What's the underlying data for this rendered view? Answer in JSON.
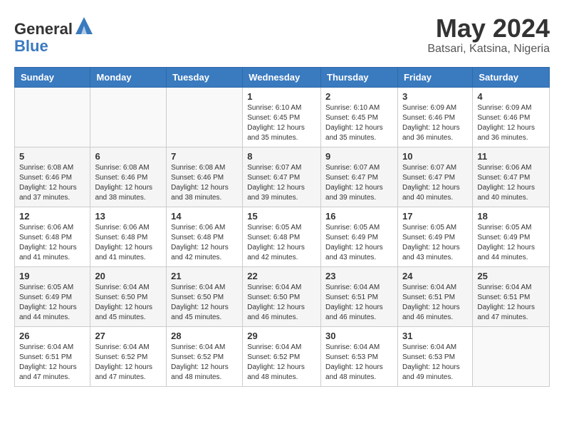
{
  "header": {
    "logo_general": "General",
    "logo_blue": "Blue",
    "month_title": "May 2024",
    "location": "Batsari, Katsina, Nigeria"
  },
  "weekdays": [
    "Sunday",
    "Monday",
    "Tuesday",
    "Wednesday",
    "Thursday",
    "Friday",
    "Saturday"
  ],
  "weeks": [
    [
      {
        "day": "",
        "info": ""
      },
      {
        "day": "",
        "info": ""
      },
      {
        "day": "",
        "info": ""
      },
      {
        "day": "1",
        "info": "Sunrise: 6:10 AM\nSunset: 6:45 PM\nDaylight: 12 hours\nand 35 minutes."
      },
      {
        "day": "2",
        "info": "Sunrise: 6:10 AM\nSunset: 6:45 PM\nDaylight: 12 hours\nand 35 minutes."
      },
      {
        "day": "3",
        "info": "Sunrise: 6:09 AM\nSunset: 6:46 PM\nDaylight: 12 hours\nand 36 minutes."
      },
      {
        "day": "4",
        "info": "Sunrise: 6:09 AM\nSunset: 6:46 PM\nDaylight: 12 hours\nand 36 minutes."
      }
    ],
    [
      {
        "day": "5",
        "info": "Sunrise: 6:08 AM\nSunset: 6:46 PM\nDaylight: 12 hours\nand 37 minutes."
      },
      {
        "day": "6",
        "info": "Sunrise: 6:08 AM\nSunset: 6:46 PM\nDaylight: 12 hours\nand 38 minutes."
      },
      {
        "day": "7",
        "info": "Sunrise: 6:08 AM\nSunset: 6:46 PM\nDaylight: 12 hours\nand 38 minutes."
      },
      {
        "day": "8",
        "info": "Sunrise: 6:07 AM\nSunset: 6:47 PM\nDaylight: 12 hours\nand 39 minutes."
      },
      {
        "day": "9",
        "info": "Sunrise: 6:07 AM\nSunset: 6:47 PM\nDaylight: 12 hours\nand 39 minutes."
      },
      {
        "day": "10",
        "info": "Sunrise: 6:07 AM\nSunset: 6:47 PM\nDaylight: 12 hours\nand 40 minutes."
      },
      {
        "day": "11",
        "info": "Sunrise: 6:06 AM\nSunset: 6:47 PM\nDaylight: 12 hours\nand 40 minutes."
      }
    ],
    [
      {
        "day": "12",
        "info": "Sunrise: 6:06 AM\nSunset: 6:48 PM\nDaylight: 12 hours\nand 41 minutes."
      },
      {
        "day": "13",
        "info": "Sunrise: 6:06 AM\nSunset: 6:48 PM\nDaylight: 12 hours\nand 41 minutes."
      },
      {
        "day": "14",
        "info": "Sunrise: 6:06 AM\nSunset: 6:48 PM\nDaylight: 12 hours\nand 42 minutes."
      },
      {
        "day": "15",
        "info": "Sunrise: 6:05 AM\nSunset: 6:48 PM\nDaylight: 12 hours\nand 42 minutes."
      },
      {
        "day": "16",
        "info": "Sunrise: 6:05 AM\nSunset: 6:49 PM\nDaylight: 12 hours\nand 43 minutes."
      },
      {
        "day": "17",
        "info": "Sunrise: 6:05 AM\nSunset: 6:49 PM\nDaylight: 12 hours\nand 43 minutes."
      },
      {
        "day": "18",
        "info": "Sunrise: 6:05 AM\nSunset: 6:49 PM\nDaylight: 12 hours\nand 44 minutes."
      }
    ],
    [
      {
        "day": "19",
        "info": "Sunrise: 6:05 AM\nSunset: 6:49 PM\nDaylight: 12 hours\nand 44 minutes."
      },
      {
        "day": "20",
        "info": "Sunrise: 6:04 AM\nSunset: 6:50 PM\nDaylight: 12 hours\nand 45 minutes."
      },
      {
        "day": "21",
        "info": "Sunrise: 6:04 AM\nSunset: 6:50 PM\nDaylight: 12 hours\nand 45 minutes."
      },
      {
        "day": "22",
        "info": "Sunrise: 6:04 AM\nSunset: 6:50 PM\nDaylight: 12 hours\nand 46 minutes."
      },
      {
        "day": "23",
        "info": "Sunrise: 6:04 AM\nSunset: 6:51 PM\nDaylight: 12 hours\nand 46 minutes."
      },
      {
        "day": "24",
        "info": "Sunrise: 6:04 AM\nSunset: 6:51 PM\nDaylight: 12 hours\nand 46 minutes."
      },
      {
        "day": "25",
        "info": "Sunrise: 6:04 AM\nSunset: 6:51 PM\nDaylight: 12 hours\nand 47 minutes."
      }
    ],
    [
      {
        "day": "26",
        "info": "Sunrise: 6:04 AM\nSunset: 6:51 PM\nDaylight: 12 hours\nand 47 minutes."
      },
      {
        "day": "27",
        "info": "Sunrise: 6:04 AM\nSunset: 6:52 PM\nDaylight: 12 hours\nand 47 minutes."
      },
      {
        "day": "28",
        "info": "Sunrise: 6:04 AM\nSunset: 6:52 PM\nDaylight: 12 hours\nand 48 minutes."
      },
      {
        "day": "29",
        "info": "Sunrise: 6:04 AM\nSunset: 6:52 PM\nDaylight: 12 hours\nand 48 minutes."
      },
      {
        "day": "30",
        "info": "Sunrise: 6:04 AM\nSunset: 6:53 PM\nDaylight: 12 hours\nand 48 minutes."
      },
      {
        "day": "31",
        "info": "Sunrise: 6:04 AM\nSunset: 6:53 PM\nDaylight: 12 hours\nand 49 minutes."
      },
      {
        "day": "",
        "info": ""
      }
    ]
  ]
}
